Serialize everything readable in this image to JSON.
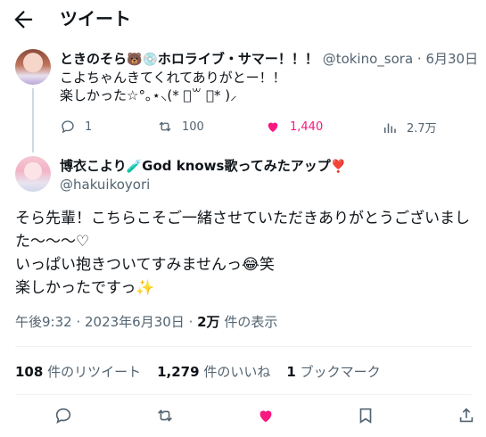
{
  "header": {
    "title": "ツイート"
  },
  "tweet1": {
    "author_name": "ときのそら",
    "author_name_suffix": "ホロライブ・サマー！！！",
    "author_emoji_1": "🐻",
    "author_emoji_2": "💿",
    "handle": "@tokino_sora",
    "date": "· 6月30日",
    "text": "こよちゃんきてくれてありがとー！！\n楽しかった☆°｡⋆⸜(* ॑꒳ ॑* )⸝",
    "replies": "1",
    "retweets": "100",
    "likes": "1,440",
    "views": "2.7万"
  },
  "tweet2": {
    "author_name": "博衣こより",
    "author_emoji": "🧪",
    "author_name_suffix": "God knows歌ってみたアップ",
    "author_emoji_2": "❣️",
    "handle": "@hakuikoyori",
    "text": "そら先輩！こちらこそご一緒させていただきありがとうございまし\nた〜〜〜♡\nいっぱい抱きついてすみませんっ😂笑\n楽しかったですっ✨",
    "time": "午後9:32",
    "date": "2023年6月30日",
    "views_count": "2万",
    "views_label": "件の表示",
    "retweets_count": "108",
    "retweets_label": "件のリツイート",
    "likes_count": "1,279",
    "likes_label": "件のいいね",
    "bookmarks_count": "1",
    "bookmarks_label": "ブックマーク"
  },
  "colors": {
    "like": "#f91880",
    "muted": "#536471",
    "text": "#0f1419"
  }
}
